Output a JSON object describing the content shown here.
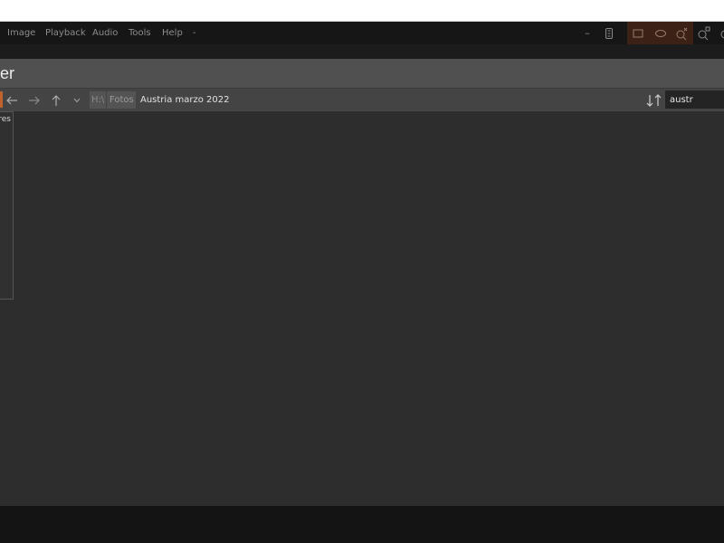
{
  "menu": {
    "items": [
      {
        "id": "image",
        "label": "Image"
      },
      {
        "id": "playback",
        "label": "Playback"
      },
      {
        "id": "audio",
        "label": "Audio"
      },
      {
        "id": "tools",
        "label": "Tools"
      },
      {
        "id": "help",
        "label": "Help"
      },
      {
        "id": "more",
        "label": "-"
      }
    ]
  },
  "window_controls": {
    "minimize_glyph": "–",
    "icons": [
      "sidebar-icon",
      "window-icon",
      "fullscreen-icon",
      "zoom-fit-icon",
      "zoom-icon",
      "search-zoom-icon"
    ]
  },
  "panel": {
    "title": "wser"
  },
  "toolbar": {
    "breadcrumb": {
      "drive": "H:\\",
      "folder": "Fotos",
      "current": "Austria marzo 2022"
    },
    "sort_icon": "sort-icon",
    "search": {
      "value": "austr"
    }
  },
  "side_popup": {
    "label": "res"
  },
  "colors": {
    "accent": "#c0622d",
    "background": "#2d2d2d",
    "header": "#505050",
    "toolbar": "#444444"
  }
}
